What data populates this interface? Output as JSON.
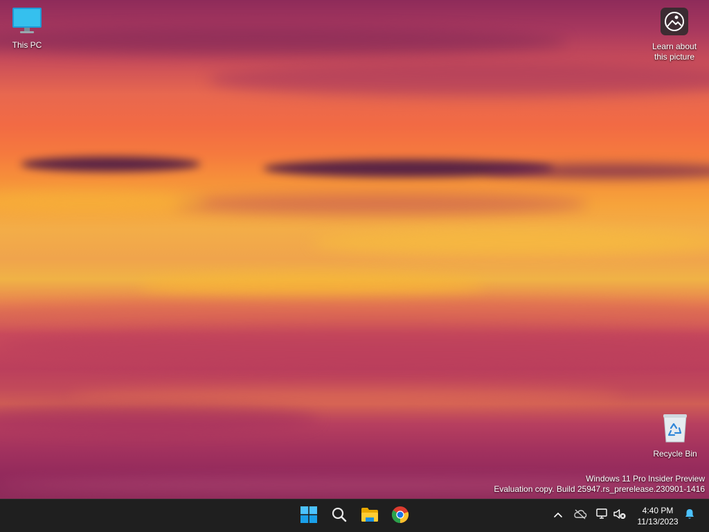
{
  "desktop": {
    "icons": [
      {
        "label": "This PC",
        "icon": "monitor-icon"
      },
      {
        "label": "Learn about this picture",
        "icon": "learn-about-picture-icon"
      },
      {
        "label": "Recycle Bin",
        "icon": "recycle-bin-icon"
      }
    ],
    "watermark": {
      "line1": "Windows 11 Pro Insider Preview",
      "line2": "Evaluation copy. Build 25947.rs_prerelease.230901-1416"
    }
  },
  "taskbar": {
    "pinned": [
      {
        "name": "Start",
        "icon": "windows-logo-icon"
      },
      {
        "name": "Search",
        "icon": "search-icon"
      },
      {
        "name": "File Explorer",
        "icon": "folder-icon"
      },
      {
        "name": "Google Chrome",
        "icon": "chrome-icon"
      }
    ],
    "tray": {
      "icons": [
        "chevron-up-icon",
        "cloud-offline-icon",
        "network-icon",
        "volume-muted-icon",
        "notification-bell-icon"
      ],
      "time": "4:40 PM",
      "date": "11/13/2023"
    }
  },
  "colors": {
    "taskbar_bg": "#1f1f1f",
    "wallpaper_top": "#8e2b5a",
    "wallpaper_mid": "#f6a33b",
    "accent_blue": "#4cc2ff"
  }
}
